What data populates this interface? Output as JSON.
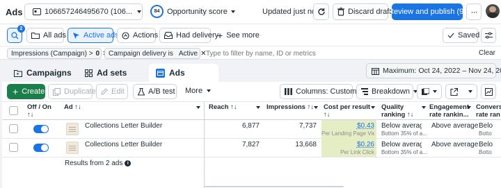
{
  "topbar": {
    "title": "Ads",
    "account_id": "106657246495670 (106...",
    "score_value": "84",
    "score_label": "Opportunity score",
    "updated_text": "Updated just now",
    "discard_label": "Discard drafts",
    "publish_label": "Review and publish (9)"
  },
  "filters": {
    "search_badge": "2",
    "all_ads": "All ads",
    "active_ads": "Active ads",
    "actions": "Actions",
    "had_delivery": "Had delivery",
    "see_more": "See more",
    "saved": "Saved"
  },
  "searchbar": {
    "chip1_prefix": "Impressions (Campaign) >",
    "chip1_value": "0",
    "chip2_prefix": "Campaign delivery is",
    "chip2_value": "Active",
    "placeholder": "Type to filter by name, ID or metrics",
    "clear_label": "Clear"
  },
  "tabs": {
    "campaigns": "Campaigns",
    "ad_sets": "Ad sets",
    "ads": "Ads",
    "date_range": "Maximum: Oct 24, 2022 – Nov 24, 2025"
  },
  "toolbar": {
    "create": "Create",
    "duplicate": "Duplicate",
    "edit": "Edit",
    "ab_test": "A/B test",
    "more": "More",
    "columns": "Columns: Custom",
    "breakdown": "Breakdown"
  },
  "table": {
    "headers": {
      "off_on": "Off / On",
      "sort": "↑↓",
      "ad": "Ad ↑↓",
      "reach": "Reach ↑↓",
      "impressions": "Impressions ↑↓",
      "cost_per_result": "Cost per result",
      "quality_1": "Quality",
      "quality_2": "ranking ↑↓",
      "engagement_1": "Engagement",
      "engagement_2": "rate rankin...",
      "conversion_1": "Conversi",
      "conversion_2": "rate ran"
    },
    "rows": [
      {
        "name": "Collections Letter Builder",
        "reach": "6,877",
        "impressions": "7,737",
        "cost": "$0.43",
        "cost_sub": "Per Landing Page Vie...",
        "quality": "Below average",
        "quality_sub": "Bottom 35% of a...",
        "engagement": "Above average",
        "conversion": "Belo",
        "conversion_sub": "Botto"
      },
      {
        "name": "Collections Letter Builder",
        "reach": "7,827",
        "impressions": "13,668",
        "cost": "$0.26",
        "cost_sub": "Per Link Click",
        "quality": "Below average",
        "quality_sub": "Bottom 35% of a...",
        "engagement": "Above average",
        "conversion": "Belo",
        "conversion_sub": "Botto"
      }
    ],
    "results_text": "Results from 2 ads"
  },
  "colors": {
    "accent": "#1b74e4",
    "create": "#1a7f4b",
    "highlight": "#e5edc4"
  }
}
